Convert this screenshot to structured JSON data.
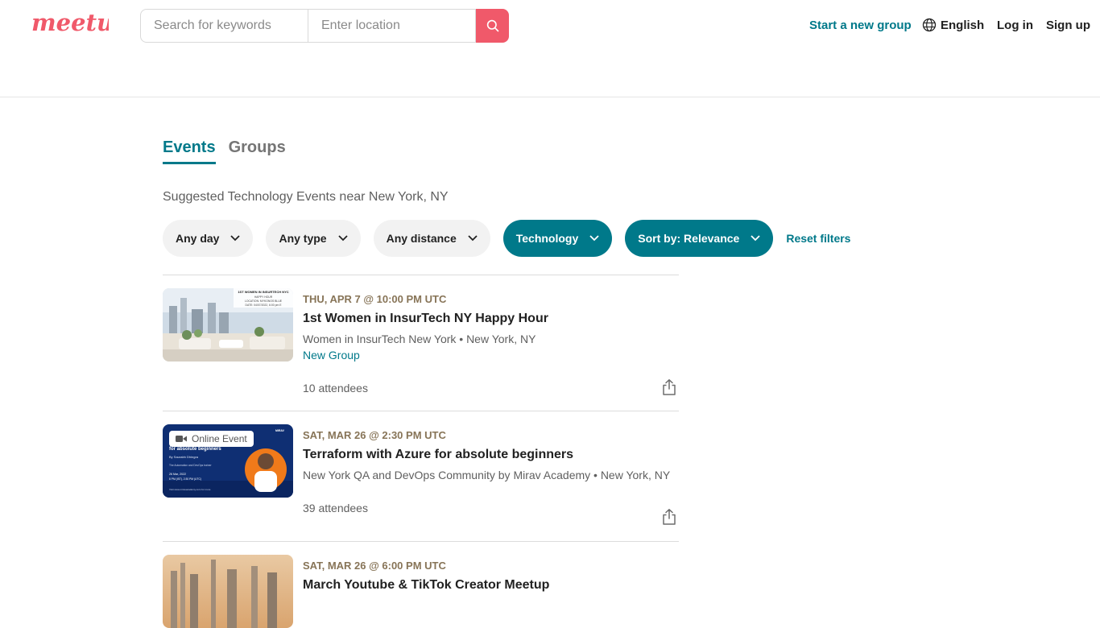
{
  "header": {
    "search_keywords_placeholder": "Search for keywords",
    "search_location_placeholder": "Enter location",
    "start_group": "Start a new group",
    "language": "English",
    "login": "Log in",
    "signup": "Sign up"
  },
  "tabs": [
    {
      "label": "Events",
      "active": true
    },
    {
      "label": "Groups",
      "active": false
    }
  ],
  "suggested_text": "Suggested Technology Events near New York, NY",
  "filters": {
    "day": "Any day",
    "type": "Any type",
    "distance": "Any distance",
    "category": "Technology",
    "sort": "Sort by: Relevance",
    "reset": "Reset filters"
  },
  "events": [
    {
      "date": "THU, APR 7 @ 10:00 PM UTC",
      "title": "1st Women in InsurTech NY Happy Hour",
      "group": "Women in InsurTech New York • New York, NY",
      "new_group": "New Group",
      "attendees": "10 attendees",
      "thumb_caption": "1ST WOMEN IN INSURTECH NYC HAPPY HOUR LOCATION: MYKONOS BLUE DATE: 04/07/2022, 6:00 pm E"
    },
    {
      "date": "SAT, MAR 26 @ 2:30 PM UTC",
      "title": "Terraform with Azure for absolute beginners",
      "group": "New York QA and DevOps Community by Mirav Academy • New York, NY",
      "badge": "Online Event",
      "attendees": "39 attendees",
      "thumb_caption": "for absolute beginners By Saurabh Dhingra 26 Mar, 2022"
    },
    {
      "date": "SAT, MAR 26 @ 6:00 PM UTC",
      "title": "March Youtube & TikTok Creator Meetup"
    }
  ],
  "colors": {
    "brand": "#f0596a",
    "teal": "#00798a",
    "date": "#877457"
  }
}
